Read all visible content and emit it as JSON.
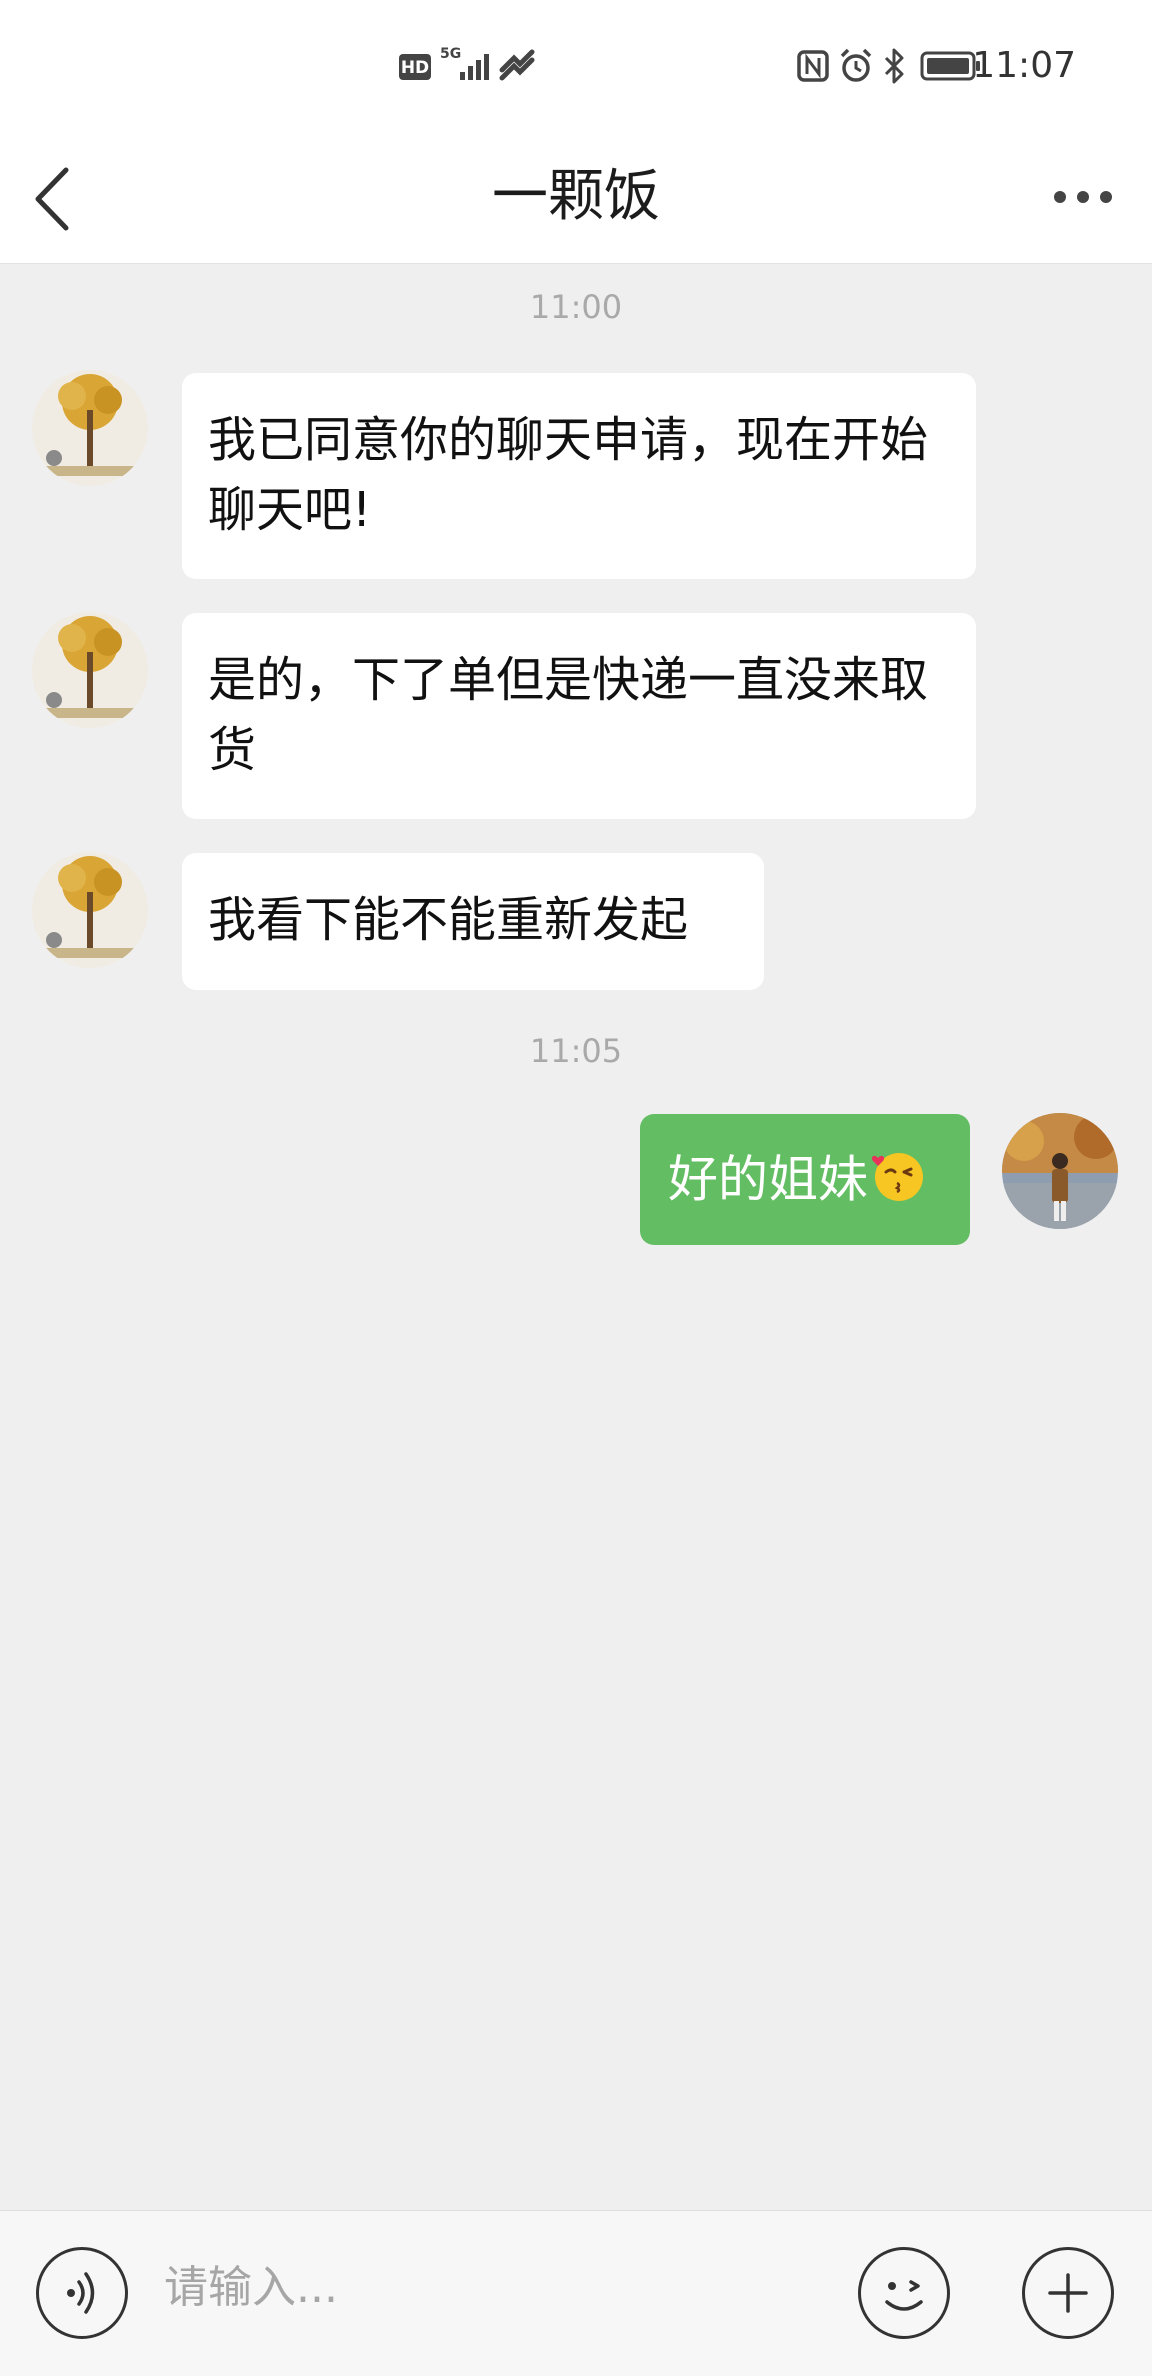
{
  "status_bar": {
    "time": "11:07",
    "network_label": "5G",
    "hd_label": "HD"
  },
  "header": {
    "title": "一颗饭"
  },
  "messages": [
    {
      "type": "timestamp",
      "text": "11:00"
    },
    {
      "type": "incoming",
      "text": "我已同意你的聊天申请，现在开始聊天吧!"
    },
    {
      "type": "incoming",
      "text": "是的，下了单但是快递一直没来取货"
    },
    {
      "type": "incoming",
      "text": "我看下能不能重新发起"
    },
    {
      "type": "timestamp",
      "text": "11:05"
    },
    {
      "type": "outgoing",
      "text": "好的姐妹",
      "emoji": "😘"
    }
  ],
  "input_bar": {
    "placeholder": "请输入..."
  },
  "colors": {
    "outgoing_bubble": "#63bd63",
    "incoming_bubble": "#ffffff",
    "background": "#efefef"
  }
}
